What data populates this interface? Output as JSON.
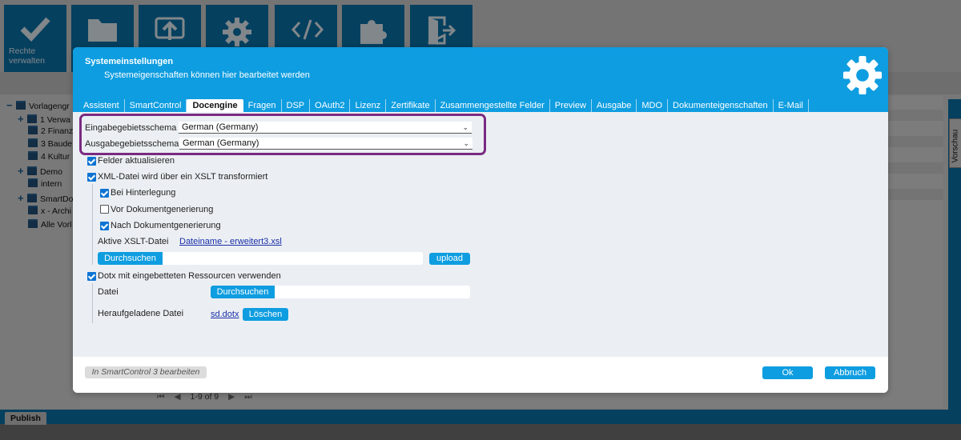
{
  "background": {
    "toolbar_buttons": [
      {
        "icon": "check-icon",
        "label_line1": "Rechte",
        "label_line2": "verwalten"
      },
      {
        "icon": "folder-icon"
      },
      {
        "icon": "upload-icon"
      },
      {
        "icon": "gear-icon"
      },
      {
        "icon": "code-icon"
      },
      {
        "icon": "puzzle-icon"
      },
      {
        "icon": "exit-icon"
      }
    ],
    "tree": [
      "Vorlagengr",
      "1 Verwa",
      "2 Finanz",
      "3 Baude",
      "4 Kultur",
      "Demo",
      "intern",
      "SmartDo",
      "x - Archi",
      "Alle Vorl"
    ],
    "pager_text": "1-9 of 9",
    "side_tab": "Vorschau",
    "publish_tab": "Publish"
  },
  "dialog": {
    "title": "Systemeinstellungen",
    "subtitle": "Systemeigenschaften können hier bearbeitet werden",
    "tabs": [
      "Assistent",
      "SmartControl",
      "Docengine",
      "Fragen",
      "DSP",
      "OAuth2",
      "Lizenz",
      "Zertifikate",
      "Zusammengestellte Felder",
      "Preview",
      "Ausgabe",
      "MDO",
      "Dokumenteigenschaften",
      "E-Mail"
    ],
    "active_tab": "Docengine",
    "input_schema_label": "Eingabegebietsschema",
    "input_schema_value": "German (Germany)",
    "output_schema_label": "Ausgabegebietsschema",
    "output_schema_value": "German (Germany)",
    "update_fields_label": "Felder aktualisieren",
    "xslt_label": "XML-Datei wird über ein XSLT transformiert",
    "on_deposit_label": "Bei Hinterlegung",
    "before_gen_label": "Vor Dokumentgenerierung",
    "after_gen_label": "Nach Dokumentgenerierung",
    "active_xslt_label": "Aktive XSLT-Datei",
    "active_xslt_file": "Dateiname - erweitert3.xsl",
    "browse_label": "Durchsuchen",
    "upload_label": "upload",
    "dotx_label": "Dotx mit eingebetteten Ressourcen verwenden",
    "file_label": "Datei",
    "uploaded_file_label": "Heraufgeladene Datei",
    "uploaded_file_name": "sd.dotx",
    "delete_label": "Löschen",
    "edit_in_smartcontrol": "In SmartControl 3 bearbeiten",
    "ok_label": "Ok",
    "cancel_label": "Abbruch",
    "checkbox_states": {
      "update_fields": true,
      "xslt": true,
      "on_deposit": true,
      "before_gen": false,
      "after_gen": true,
      "dotx": true
    }
  }
}
